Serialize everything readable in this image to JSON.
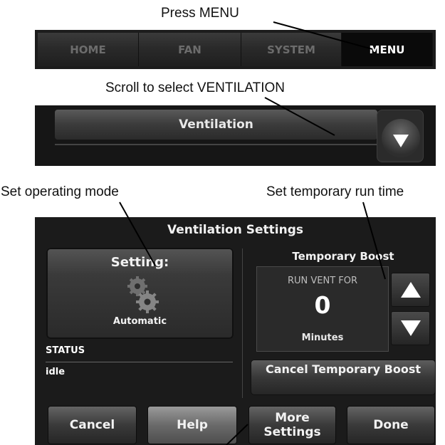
{
  "annotations": {
    "press_menu": "Press MENU",
    "scroll_select": "Scroll to select VENTILATION",
    "operating_mode": "Set operating mode",
    "run_time": "Set temporary run time"
  },
  "nav": {
    "tabs": [
      {
        "label": "HOME",
        "active": false
      },
      {
        "label": "FAN",
        "active": false
      },
      {
        "label": "SYSTEM",
        "active": false
      },
      {
        "label": "MENU",
        "active": true
      }
    ]
  },
  "menu_list": {
    "selected_item": "Ventilation",
    "scroll_icon": "chevron-down-icon"
  },
  "settings_screen": {
    "title": "Ventilation Settings",
    "setting": {
      "label": "Setting:",
      "value": "Automatic",
      "icon": "gears-icon"
    },
    "status": {
      "heading": "STATUS",
      "value": "idle"
    },
    "boost": {
      "heading": "Temporary Boost",
      "run_label": "RUN VENT FOR",
      "value": "0",
      "unit": "Minutes",
      "cancel_label": "Cancel Temporary Boost"
    },
    "buttons": {
      "cancel": "Cancel",
      "help": "Help",
      "more_line1": "More",
      "more_line2": "Settings",
      "done": "Done"
    }
  },
  "colors": {
    "panel_bg": "#1b1b1b",
    "text": "#f2f2f2",
    "active_tab_bg": "#0a0a0a"
  }
}
